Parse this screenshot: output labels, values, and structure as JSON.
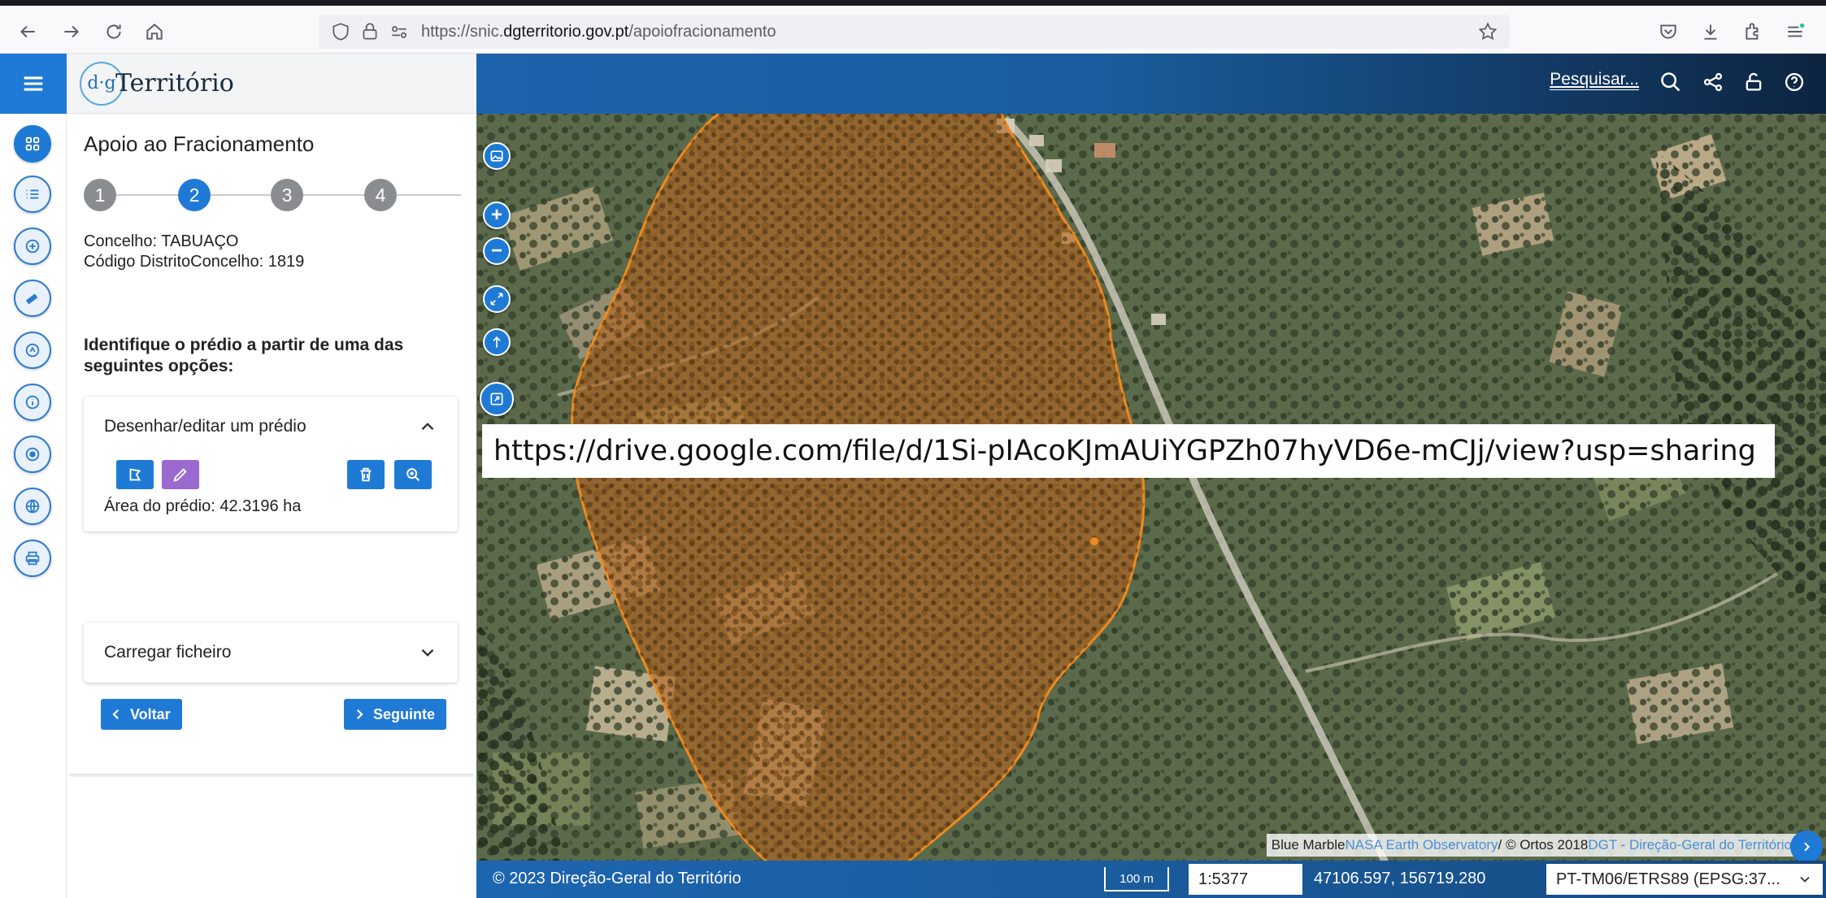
{
  "browser": {
    "url_prefix": "https://snic.",
    "url_domain": "dgterritorio.gov.pt",
    "url_path": "/apoiofracionamento"
  },
  "brand": {
    "logo_mark": "d·g",
    "logo_word": "Território"
  },
  "panel": {
    "title": "Apoio ao Fracionamento",
    "steps": [
      "1",
      "2",
      "3",
      "4"
    ],
    "active_step": 2,
    "concelho": "Concelho: TABUAÇO",
    "codigo": "Código DistritoConcelho: 1819",
    "instruction": "Identifique o prédio a partir de uma das seguintes opções:",
    "draw_card": {
      "title": "Desenhar/editar um prédio",
      "area": "Área do prédio: 42.3196 ha"
    },
    "upload_card": {
      "title": "Carregar ficheiro"
    },
    "back_label": "Voltar",
    "next_label": "Seguinte"
  },
  "map": {
    "search_label": "Pesquisar...",
    "share_url": "https://drive.google.com/file/d/1Si-pIAcoKJmAUiYGPZh07hyVD6e-mCJj/view?usp=sharing",
    "attribution": {
      "blue_marble": "Blue Marble ",
      "nasa": "NASA Earth Observatory",
      "sep": " / © Ortos 2018 ",
      "dgt": "DGT - Direção-Geral do Território"
    },
    "copyright": "© 2023 Direção-Geral do Território",
    "scale_bar": "100 m",
    "scale": "1:5377",
    "coordinates": "47106.597, 156719.280",
    "crs": "PT-TM06/ETRS89 (EPSG:37..."
  },
  "colors": {
    "primary": "#1f7ad6",
    "edit_button": "#9b6ad1",
    "parcel_outline": "#f08a1e",
    "parcel_fill": "#b5651d"
  }
}
